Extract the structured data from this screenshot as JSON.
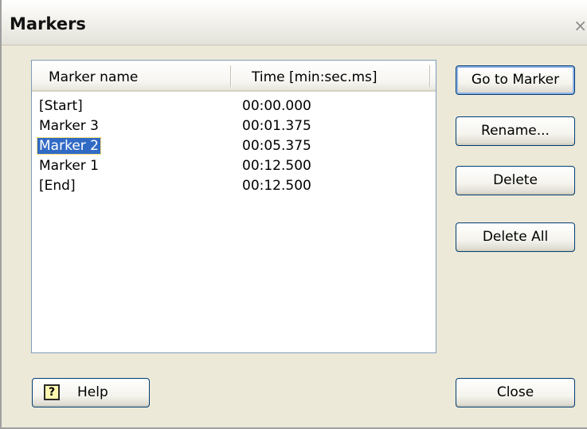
{
  "window": {
    "title": "Markers",
    "close_glyph": "×"
  },
  "list": {
    "columns": [
      "Marker name",
      "Time [min:sec.ms]"
    ],
    "rows": [
      {
        "name": "[Start]",
        "time": "00:00.000"
      },
      {
        "name": "Marker 3",
        "time": "00:01.375"
      },
      {
        "name": "Marker 2",
        "time": "00:05.375",
        "selected": true
      },
      {
        "name": "Marker 1",
        "time": "00:12.500"
      },
      {
        "name": "[End]",
        "time": "00:12.500"
      }
    ]
  },
  "buttons": {
    "go_to_marker": "Go to Marker",
    "rename": "Rename...",
    "delete": "Delete",
    "delete_all": "Delete All",
    "help": "Help",
    "close": "Close"
  },
  "icons": {
    "help": "help-question-icon",
    "close": "close-icon"
  },
  "colors": {
    "selection": "#316ac5",
    "dialog_bg": "#ece9d8"
  }
}
